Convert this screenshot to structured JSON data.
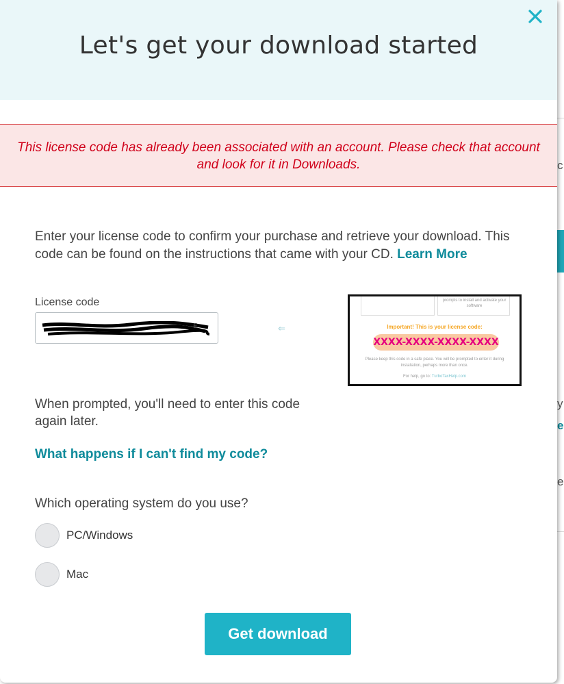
{
  "modal": {
    "title": "Let's get your download started",
    "close_icon": "close-icon"
  },
  "error": {
    "message": "This license code has already been associated with an account. Please check that account and look for it in Downloads."
  },
  "intro": {
    "text": "Enter your license code to confirm your purchase and retrieve your download. This code can be found on the instructions that came with your CD. ",
    "learn_more": "Learn More"
  },
  "license": {
    "label": "License code",
    "value_redacted": true
  },
  "sample_card": {
    "box_text": "prompts to install and activate your software",
    "important": "Important! This is your license code:",
    "code": "XXXX-XXXX-XXXX-XXXX",
    "note": "Please keep this code in a safe place. You will be prompted to enter it during installation, perhaps more than once.",
    "help_prefix": "For help, go to: ",
    "help_link": "TurboTaxHelp.com"
  },
  "prompt_note": "When prompted, you'll need to enter this code again later.",
  "help_link": "What happens if I can't find my code?",
  "os": {
    "question": "Which operating system do you use?",
    "options": [
      {
        "label": "PC/Windows",
        "selected": false
      },
      {
        "label": "Mac",
        "selected": false
      }
    ]
  },
  "actions": {
    "get_download": "Get download"
  },
  "colors": {
    "accent": "#1fb3c7",
    "link": "#0f8b9b",
    "error": "#d0021b",
    "error_bg": "#fbe6e6",
    "header_bg": "#eaf7f9"
  }
}
